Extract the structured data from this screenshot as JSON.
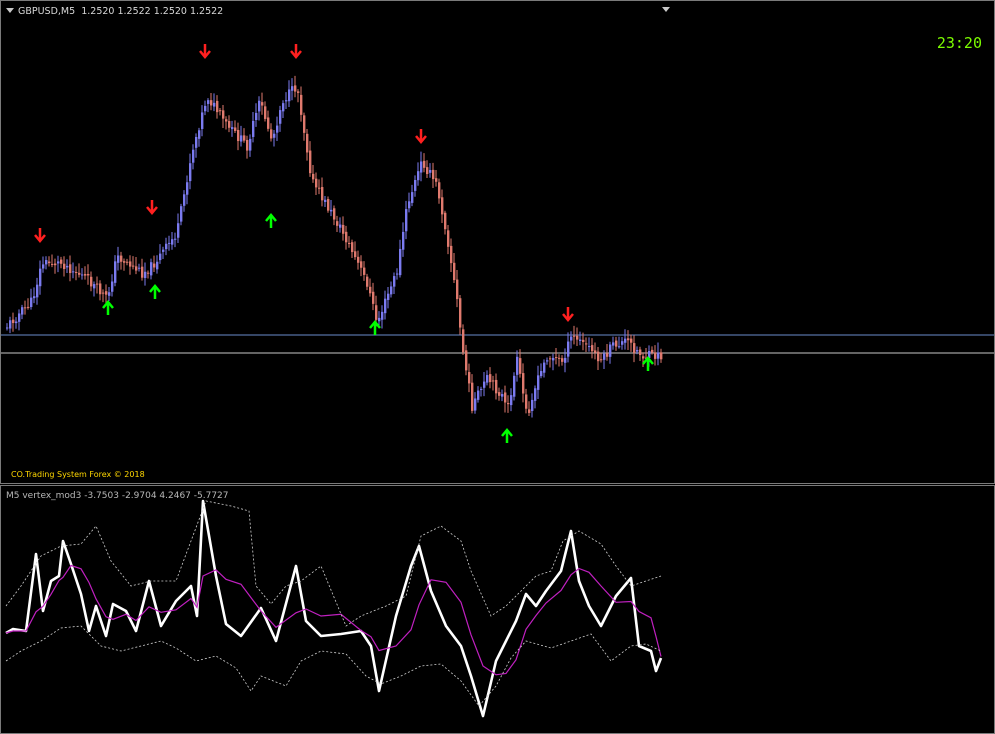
{
  "chart": {
    "symbol_line": "GBPUSD,M5  1.2520 1.2522 1.2520 1.2522",
    "clock": "23:20",
    "copyright": "CO.Trading System Forex © 2018",
    "colors": {
      "bull": "#7b7bf0",
      "bear": "#e07a6e",
      "up_arrow": "#00ff00",
      "down_arrow": "#ff2020",
      "hline": "#6a8ccc"
    }
  },
  "indicator": {
    "header": "M5 vertex_mod3 -3.7503 -2.9704 4.2467 -5.7727",
    "colors": {
      "main": "#ffffff",
      "signal": "#c020c0",
      "band": "#d0d0d0"
    }
  }
}
